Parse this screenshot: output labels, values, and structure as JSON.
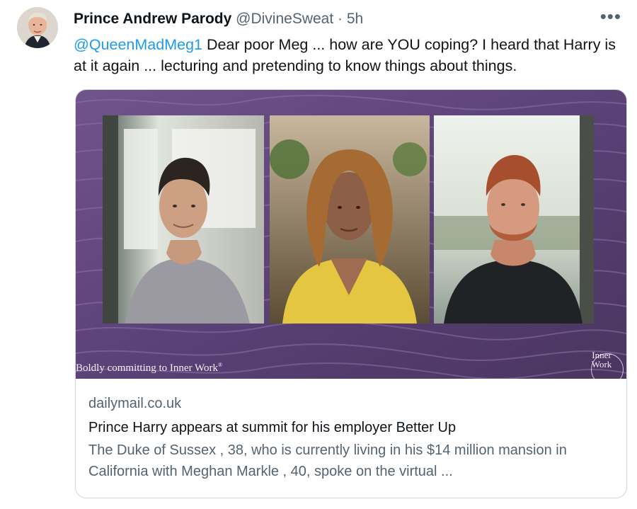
{
  "tweet": {
    "author_name": "Prince Andrew Parody",
    "author_handle": "@DivineSweat",
    "separator": "·",
    "time": "5h",
    "more_icon": "more-horizontal-icon",
    "mention": "@QueenMadMeg1",
    "body": "Dear poor Meg ... how are YOU coping? I heard that Harry is at it again ... lecturing and pretending to know things about things."
  },
  "card": {
    "image_caption": "Boldly committing to Inner Work",
    "image_caption_mark": "®",
    "image_brand": "Inner Work",
    "domain": "dailymail.co.uk",
    "title": "Prince Harry appears at summit for his employer Better Up",
    "description": "The Duke of Sussex , 38, who is currently living in his $14 million mansion in California with Meghan Markle , 40, spoke on the virtual ..."
  },
  "colors": {
    "link": "#1d9bf0",
    "text": "#0f1419",
    "muted": "#536471",
    "border": "#cfd9de",
    "media_background": "#5a3f78"
  }
}
